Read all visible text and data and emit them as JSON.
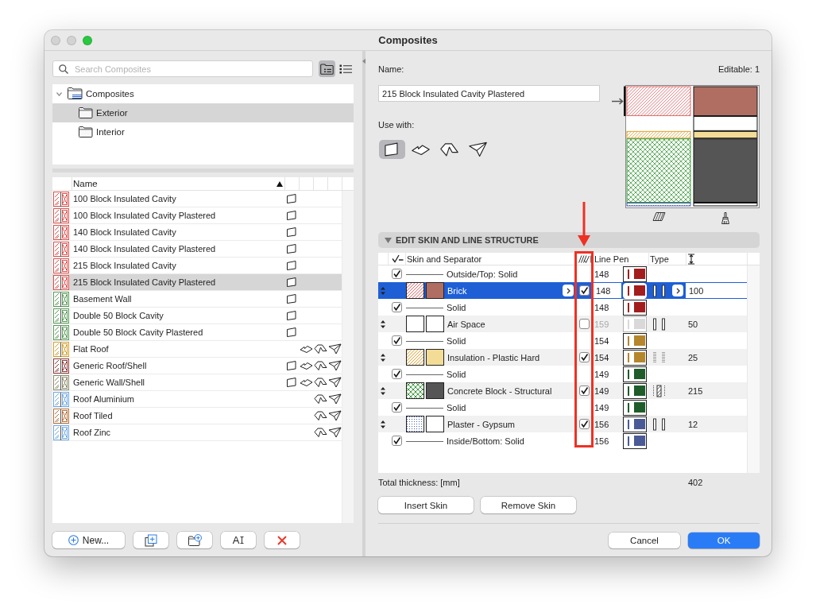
{
  "window": {
    "title": "Composites",
    "controls": [
      {
        "kind": "close",
        "disabled": true
      },
      {
        "kind": "minimize",
        "disabled": true
      },
      {
        "kind": "zoom",
        "disabled": false
      }
    ]
  },
  "sidebar": {
    "search": {
      "placeholder": "Search Composites"
    },
    "view_modes": [
      {
        "kind": "tree",
        "selected": true
      },
      {
        "kind": "list",
        "selected": false
      }
    ],
    "tree": [
      {
        "label": "Composites",
        "expanded": true,
        "selected": false,
        "children": [
          {
            "label": "Exterior",
            "selected": true
          },
          {
            "label": "Interior",
            "selected": false
          }
        ]
      }
    ],
    "list": {
      "columns": [
        {
          "label": "Name",
          "sort_ascending": true
        }
      ],
      "rows": [
        {
          "name": "100 Block Insulated Cavity",
          "color": "#d9534f",
          "selected": false,
          "use_with": {
            "wall": true,
            "slab": false,
            "roof": false,
            "shell": false
          }
        },
        {
          "name": "100 Block Insulated Cavity Plastered",
          "color": "#d9534f",
          "selected": false,
          "use_with": {
            "wall": true,
            "slab": false,
            "roof": false,
            "shell": false
          }
        },
        {
          "name": "140 Block Insulated Cavity",
          "color": "#d9534f",
          "selected": false,
          "use_with": {
            "wall": true,
            "slab": false,
            "roof": false,
            "shell": false
          }
        },
        {
          "name": "140 Block Insulated Cavity Plastered",
          "color": "#d9534f",
          "selected": false,
          "use_with": {
            "wall": true,
            "slab": false,
            "roof": false,
            "shell": false
          }
        },
        {
          "name": "215 Block Insulated Cavity",
          "color": "#d9534f",
          "selected": false,
          "use_with": {
            "wall": true,
            "slab": false,
            "roof": false,
            "shell": false
          }
        },
        {
          "name": "215 Block Insulated Cavity Plastered",
          "color": "#d9534f",
          "selected": true,
          "use_with": {
            "wall": true,
            "slab": false,
            "roof": false,
            "shell": false
          }
        },
        {
          "name": "Basement Wall",
          "color": "#5a9a5a",
          "selected": false,
          "use_with": {
            "wall": true,
            "slab": false,
            "roof": false,
            "shell": false
          }
        },
        {
          "name": "Double 50 Block Cavity",
          "color": "#5a9a5a",
          "selected": false,
          "use_with": {
            "wall": true,
            "slab": false,
            "roof": false,
            "shell": false
          }
        },
        {
          "name": "Double 50 Block Cavity Plastered",
          "color": "#5a9a5a",
          "selected": false,
          "use_with": {
            "wall": true,
            "slab": false,
            "roof": false,
            "shell": false
          }
        },
        {
          "name": "Flat Roof",
          "color": "#d4a030",
          "selected": false,
          "use_with": {
            "wall": false,
            "slab": true,
            "roof": true,
            "shell": true
          }
        },
        {
          "name": "Generic Roof/Shell",
          "color": "#8b3a3a",
          "selected": false,
          "use_with": {
            "wall": true,
            "slab": true,
            "roof": true,
            "shell": true
          }
        },
        {
          "name": "Generic Wall/Shell",
          "color": "#8a8a6a",
          "selected": false,
          "use_with": {
            "wall": true,
            "slab": true,
            "roof": true,
            "shell": true
          }
        },
        {
          "name": "Roof Aluminium",
          "color": "#6fa8e0",
          "selected": false,
          "use_with": {
            "wall": false,
            "slab": false,
            "roof": true,
            "shell": true
          }
        },
        {
          "name": "Roof Tiled",
          "color": "#b5713c",
          "selected": false,
          "use_with": {
            "wall": false,
            "slab": false,
            "roof": true,
            "shell": true
          }
        },
        {
          "name": "Roof Zinc",
          "color": "#6fa8e0",
          "selected": false,
          "use_with": {
            "wall": false,
            "slab": false,
            "roof": true,
            "shell": true
          }
        }
      ]
    },
    "buttons": [
      {
        "kind": "new",
        "label": "New..."
      },
      {
        "kind": "duplicate"
      },
      {
        "kind": "new-folder"
      },
      {
        "kind": "rename",
        "label": "A"
      },
      {
        "kind": "delete"
      }
    ]
  },
  "editor": {
    "name_label": "Name:",
    "editable": "Editable: 1",
    "name_field": {
      "value": "215 Block Insulated Cavity Plastered"
    },
    "use_with_label": "Use with:",
    "use_with": [
      {
        "kind": "wall",
        "selected": true
      },
      {
        "kind": "slab",
        "selected": false
      },
      {
        "kind": "roof",
        "selected": false
      },
      {
        "kind": "shell",
        "selected": false
      }
    ],
    "section": {
      "title": "EDIT SKIN AND LINE STRUCTURE",
      "expanded": true
    },
    "table": {
      "columns": [
        {
          "kind": "check-all",
          "highlighted": false
        },
        {
          "kind": "label",
          "label": "Skin and Separator",
          "highlighted": false
        },
        {
          "kind": "hatch-check",
          "highlighted": true
        },
        {
          "kind": "label",
          "label": "Line Pen",
          "highlighted": false
        },
        {
          "kind": "label",
          "label": "Type",
          "highlighted": false
        },
        {
          "kind": "thickness",
          "highlighted": false
        }
      ],
      "rows": [
        {
          "kind": "separator",
          "selected": false,
          "checked": true,
          "label": "Outside/Top: Solid",
          "pen": {
            "number": "148",
            "color": "#a31d1d",
            "disabled": false
          }
        },
        {
          "kind": "skin",
          "selected": true,
          "label": "Brick",
          "hatch": {
            "kind": "diagonal",
            "color": "#e06666"
          },
          "fill": {
            "color": "#b06e63"
          },
          "checked": true,
          "pen": {
            "number": "148",
            "color": "#a31d1d",
            "disabled": false
          },
          "type": {
            "kind": "double-bar"
          },
          "thickness": "100"
        },
        {
          "kind": "separator",
          "selected": false,
          "checked": true,
          "label": "Solid",
          "pen": {
            "number": "148",
            "color": "#a31d1d",
            "disabled": false
          }
        },
        {
          "kind": "skin",
          "selected": false,
          "label": "Air Space",
          "hatch": {
            "kind": "none"
          },
          "fill": {
            "color": "#ffffff"
          },
          "checked": false,
          "pen": {
            "number": "159",
            "color": "#d9d9d9",
            "disabled": true
          },
          "type": {
            "kind": "double-bar"
          },
          "thickness": "50"
        },
        {
          "kind": "separator",
          "selected": false,
          "checked": true,
          "label": "Solid",
          "pen": {
            "number": "154",
            "color": "#b5862b",
            "disabled": false
          }
        },
        {
          "kind": "skin",
          "selected": false,
          "label": "Insulation - Plastic Hard",
          "hatch": {
            "kind": "diagonal",
            "color": "#e0a030"
          },
          "fill": {
            "color": "#f3dc96"
          },
          "checked": true,
          "pen": {
            "number": "154",
            "color": "#b5862b",
            "disabled": false
          },
          "type": {
            "kind": "dotted-bar"
          },
          "thickness": "25"
        },
        {
          "kind": "separator",
          "selected": false,
          "checked": true,
          "label": "Solid",
          "pen": {
            "number": "149",
            "color": "#1e5c29",
            "disabled": false
          }
        },
        {
          "kind": "skin",
          "selected": false,
          "label": "Concrete Block - Structural",
          "hatch": {
            "kind": "crosshatch",
            "color": "#3a9a3a"
          },
          "fill": {
            "color": "#555555"
          },
          "checked": true,
          "pen": {
            "number": "149",
            "color": "#1e5c29",
            "disabled": false
          },
          "type": {
            "kind": "hatched-core"
          },
          "thickness": "215"
        },
        {
          "kind": "separator",
          "selected": false,
          "checked": true,
          "label": "Solid",
          "pen": {
            "number": "149",
            "color": "#1e5c29",
            "disabled": false
          }
        },
        {
          "kind": "skin",
          "selected": false,
          "label": "Plaster - Gypsum",
          "hatch": {
            "kind": "dots",
            "color": "#4a5eb0"
          },
          "fill": {
            "color": "#ffffff"
          },
          "checked": true,
          "pen": {
            "number": "156",
            "color": "#4a5a96",
            "disabled": false
          },
          "type": {
            "kind": "double-bar"
          },
          "thickness": "12"
        },
        {
          "kind": "separator",
          "selected": false,
          "checked": true,
          "label": "Inside/Bottom: Solid",
          "pen": {
            "number": "156",
            "color": "#4a5a96",
            "disabled": false
          }
        }
      ]
    },
    "total": {
      "label": "Total thickness: [mm]",
      "value": "402"
    },
    "skin_buttons": [
      "Insert Skin",
      "Remove Skin"
    ],
    "dialog_buttons": [
      {
        "label": "Cancel",
        "primary": false
      },
      {
        "label": "OK",
        "primary": true
      }
    ]
  }
}
